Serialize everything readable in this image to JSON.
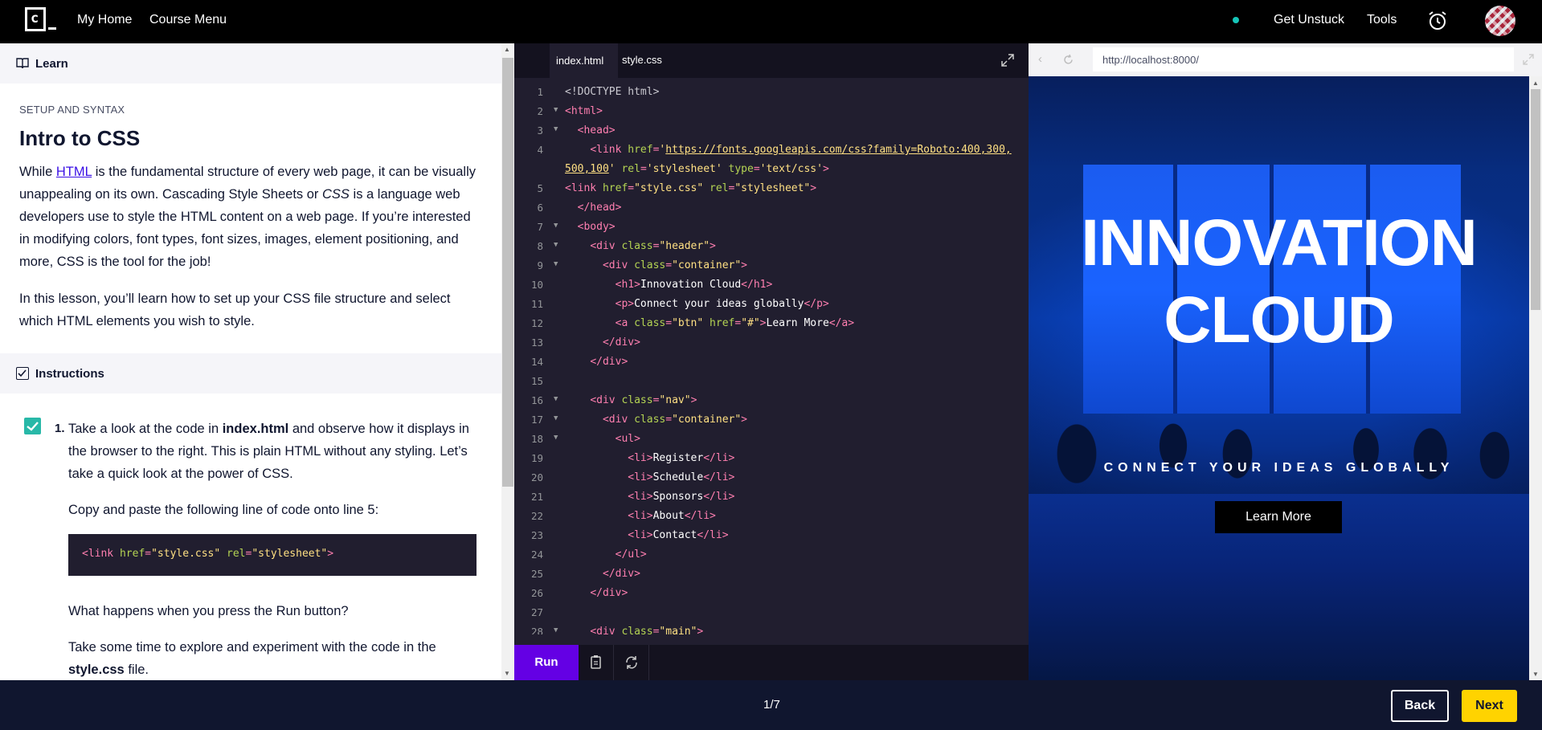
{
  "nav": {
    "my_home": "My Home",
    "course_menu": "Course Menu",
    "get_unstuck": "Get Unstuck",
    "tools": "Tools"
  },
  "colors": {
    "accent_purple": "#6400e4",
    "next_yellow": "#ffd300",
    "status_teal": "#16c5b8",
    "editor_bg": "#211e2f",
    "footer_bg": "#10162f"
  },
  "learn": {
    "header": "Learn",
    "kicker": "SETUP AND SYNTAX",
    "title": "Intro to CSS",
    "p1_before": "While ",
    "p1_link": "HTML",
    "p1_mid": " is the fundamental structure of every web page, it can be visually unappealing on its own. Cascading Style Sheets or ",
    "p1_em": "CSS",
    "p1_after": " is a language web developers use to style the HTML content on a web page. If you’re interested in modifying colors, font types, font sizes, images, element positioning, and more, CSS is the tool for the job!",
    "p2": "In this lesson, you’ll learn how to set up your CSS file structure and select which HTML elements you wish to style.",
    "instructions_header": "Instructions",
    "task_number": "1.",
    "task_t1": "Take a look at the code in ",
    "task_b1": "index.html",
    "task_t2": " and observe how it displays in the browser to the right. This is plain HTML without any styling. Let’s take a quick look at the power of CSS.",
    "task_copy": "Copy and paste the following line of code onto line 5:",
    "snippet": "<link href=\"style.css\" rel=\"stylesheet\">",
    "task_question": "What happens when you press the Run button?",
    "task_explore_1": "Take some time to explore and experiment with the code in the ",
    "task_explore_b": "style.css",
    "task_explore_2": " file."
  },
  "editor": {
    "tabs": [
      "index.html",
      "style.css"
    ],
    "run_label": "Run",
    "lines": [
      {
        "n": "1",
        "fold": false,
        "parts": [
          [
            "dim",
            "<!DOCTYPE html>"
          ]
        ]
      },
      {
        "n": "2",
        "fold": true,
        "parts": [
          [
            "tag",
            "<html>"
          ]
        ]
      },
      {
        "n": "3",
        "fold": true,
        "parts": [
          [
            "txt",
            "  "
          ],
          [
            "tag",
            "<head>"
          ]
        ]
      },
      {
        "n": "4",
        "fold": false,
        "parts": [
          [
            "txt",
            "    "
          ],
          [
            "tag",
            "<link "
          ],
          [
            "attr",
            "href"
          ],
          [
            "tag",
            "="
          ],
          [
            "val",
            "'"
          ],
          [
            "url",
            "https://fonts.googleapis.com/css?family=Roboto:400,300,"
          ]
        ]
      },
      {
        "n": "",
        "fold": false,
        "parts": [
          [
            "url",
            "500,100"
          ],
          [
            "val",
            "'"
          ],
          [
            "attr",
            " rel"
          ],
          [
            "tag",
            "="
          ],
          [
            "val",
            "'stylesheet'"
          ],
          [
            "attr",
            " type"
          ],
          [
            "tag",
            "="
          ],
          [
            "val",
            "'text/css'"
          ],
          [
            "tag",
            ">"
          ]
        ]
      },
      {
        "n": "5",
        "fold": false,
        "parts": [
          [
            "tag",
            "<link "
          ],
          [
            "attr",
            "href"
          ],
          [
            "tag",
            "="
          ],
          [
            "val",
            "\"style.css\""
          ],
          [
            "attr",
            " rel"
          ],
          [
            "tag",
            "="
          ],
          [
            "val",
            "\"stylesheet\""
          ],
          [
            "tag",
            ">"
          ]
        ]
      },
      {
        "n": "6",
        "fold": false,
        "parts": [
          [
            "txt",
            "  "
          ],
          [
            "tag",
            "</head>"
          ]
        ]
      },
      {
        "n": "7",
        "fold": true,
        "parts": [
          [
            "txt",
            "  "
          ],
          [
            "tag",
            "<body>"
          ]
        ]
      },
      {
        "n": "8",
        "fold": true,
        "parts": [
          [
            "txt",
            "    "
          ],
          [
            "tag",
            "<div "
          ],
          [
            "attr",
            "class"
          ],
          [
            "tag",
            "="
          ],
          [
            "val",
            "\"header\""
          ],
          [
            "tag",
            ">"
          ]
        ]
      },
      {
        "n": "9",
        "fold": true,
        "parts": [
          [
            "txt",
            "      "
          ],
          [
            "tag",
            "<div "
          ],
          [
            "attr",
            "class"
          ],
          [
            "tag",
            "="
          ],
          [
            "val",
            "\"container\""
          ],
          [
            "tag",
            ">"
          ]
        ]
      },
      {
        "n": "10",
        "fold": false,
        "parts": [
          [
            "txt",
            "        "
          ],
          [
            "tag",
            "<h1>"
          ],
          [
            "txt",
            "Innovation Cloud"
          ],
          [
            "tag",
            "</h1>"
          ]
        ]
      },
      {
        "n": "11",
        "fold": false,
        "parts": [
          [
            "txt",
            "        "
          ],
          [
            "tag",
            "<p>"
          ],
          [
            "txt",
            "Connect your ideas globally"
          ],
          [
            "tag",
            "</p>"
          ]
        ]
      },
      {
        "n": "12",
        "fold": false,
        "parts": [
          [
            "txt",
            "        "
          ],
          [
            "tag",
            "<a "
          ],
          [
            "attr",
            "class"
          ],
          [
            "tag",
            "="
          ],
          [
            "val",
            "\"btn\""
          ],
          [
            "attr",
            " href"
          ],
          [
            "tag",
            "="
          ],
          [
            "val",
            "\"#\""
          ],
          [
            "tag",
            ">"
          ],
          [
            "txt",
            "Learn More"
          ],
          [
            "tag",
            "</a>"
          ]
        ]
      },
      {
        "n": "13",
        "fold": false,
        "parts": [
          [
            "txt",
            "      "
          ],
          [
            "tag",
            "</div>"
          ]
        ]
      },
      {
        "n": "14",
        "fold": false,
        "parts": [
          [
            "txt",
            "    "
          ],
          [
            "tag",
            "</div>"
          ]
        ]
      },
      {
        "n": "15",
        "fold": false,
        "parts": []
      },
      {
        "n": "16",
        "fold": true,
        "parts": [
          [
            "txt",
            "    "
          ],
          [
            "tag",
            "<div "
          ],
          [
            "attr",
            "class"
          ],
          [
            "tag",
            "="
          ],
          [
            "val",
            "\"nav\""
          ],
          [
            "tag",
            ">"
          ]
        ]
      },
      {
        "n": "17",
        "fold": true,
        "parts": [
          [
            "txt",
            "      "
          ],
          [
            "tag",
            "<div "
          ],
          [
            "attr",
            "class"
          ],
          [
            "tag",
            "="
          ],
          [
            "val",
            "\"container\""
          ],
          [
            "tag",
            ">"
          ]
        ]
      },
      {
        "n": "18",
        "fold": true,
        "parts": [
          [
            "txt",
            "        "
          ],
          [
            "tag",
            "<ul>"
          ]
        ]
      },
      {
        "n": "19",
        "fold": false,
        "parts": [
          [
            "txt",
            "          "
          ],
          [
            "tag",
            "<li>"
          ],
          [
            "txt",
            "Register"
          ],
          [
            "tag",
            "</li>"
          ]
        ]
      },
      {
        "n": "20",
        "fold": false,
        "parts": [
          [
            "txt",
            "          "
          ],
          [
            "tag",
            "<li>"
          ],
          [
            "txt",
            "Schedule"
          ],
          [
            "tag",
            "</li>"
          ]
        ]
      },
      {
        "n": "21",
        "fold": false,
        "parts": [
          [
            "txt",
            "          "
          ],
          [
            "tag",
            "<li>"
          ],
          [
            "txt",
            "Sponsors"
          ],
          [
            "tag",
            "</li>"
          ]
        ]
      },
      {
        "n": "22",
        "fold": false,
        "parts": [
          [
            "txt",
            "          "
          ],
          [
            "tag",
            "<li>"
          ],
          [
            "txt",
            "About"
          ],
          [
            "tag",
            "</li>"
          ]
        ]
      },
      {
        "n": "23",
        "fold": false,
        "parts": [
          [
            "txt",
            "          "
          ],
          [
            "tag",
            "<li>"
          ],
          [
            "txt",
            "Contact"
          ],
          [
            "tag",
            "</li>"
          ]
        ]
      },
      {
        "n": "24",
        "fold": false,
        "parts": [
          [
            "txt",
            "        "
          ],
          [
            "tag",
            "</ul>"
          ]
        ]
      },
      {
        "n": "25",
        "fold": false,
        "parts": [
          [
            "txt",
            "      "
          ],
          [
            "tag",
            "</div>"
          ]
        ]
      },
      {
        "n": "26",
        "fold": false,
        "parts": [
          [
            "txt",
            "    "
          ],
          [
            "tag",
            "</div>"
          ]
        ]
      },
      {
        "n": "27",
        "fold": false,
        "parts": []
      },
      {
        "n": "28",
        "fold": true,
        "parts": [
          [
            "txt",
            "    "
          ],
          [
            "tag",
            "<div "
          ],
          [
            "attr",
            "class"
          ],
          [
            "tag",
            "="
          ],
          [
            "val",
            "\"main\""
          ],
          [
            "tag",
            ">"
          ]
        ]
      }
    ]
  },
  "browser": {
    "url": "http://localhost:8000/",
    "hero_title": "INNOVATION CLOUD",
    "hero_subtitle": "CONNECT YOUR IDEAS GLOBALLY",
    "hero_button": "Learn More"
  },
  "footer": {
    "progress": "1/7",
    "back_label": "Back",
    "next_label": "Next"
  },
  "icons": [
    "codecademy-logo-icon",
    "alarm-clock-icon",
    "book-icon",
    "checkbox-icon",
    "expand-icon",
    "back-arrow-icon",
    "refresh-icon",
    "copy-icon",
    "reset-icon"
  ]
}
